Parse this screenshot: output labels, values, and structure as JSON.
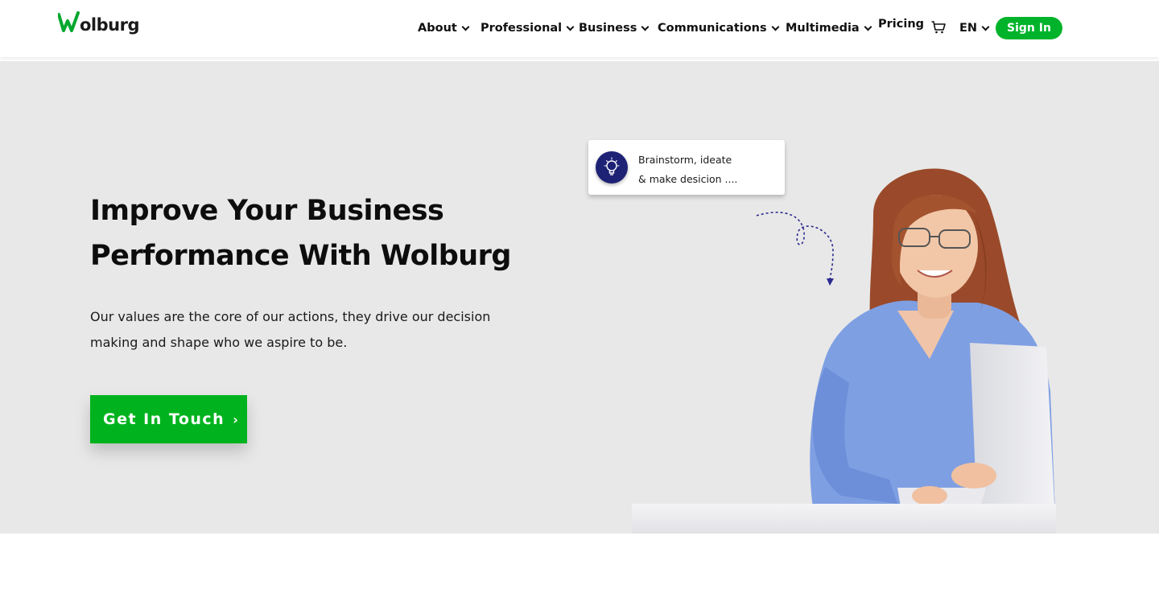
{
  "brand": {
    "logo_text": "Wolburg",
    "accent_color": "#00b31e"
  },
  "nav": {
    "items": [
      {
        "label": "About",
        "has_dropdown": true
      },
      {
        "label": "Professional",
        "has_dropdown": true
      },
      {
        "label": "Business",
        "has_dropdown": true
      },
      {
        "label": "Communications",
        "has_dropdown": true
      },
      {
        "label": "Multimedia",
        "has_dropdown": true
      },
      {
        "label": "Pricing",
        "has_dropdown": false
      }
    ],
    "cart_icon": "cart-icon",
    "language": "EN",
    "signin_label": "Sign In"
  },
  "hero": {
    "title_line1": "Improve Your Business",
    "title_line2": "Performance With Wolburg",
    "desc_line1": "Our values are the core of our actions, they drive our decision",
    "desc_line2": "making and shape who we aspire to be.",
    "cta_label": "Get In Touch",
    "cta_arrow": "›",
    "background": "#e8e8e8"
  },
  "card": {
    "icon": "lightbulb-icon",
    "line1": "Brainstorm, ideate",
    "line2": "& make desicion ...."
  }
}
